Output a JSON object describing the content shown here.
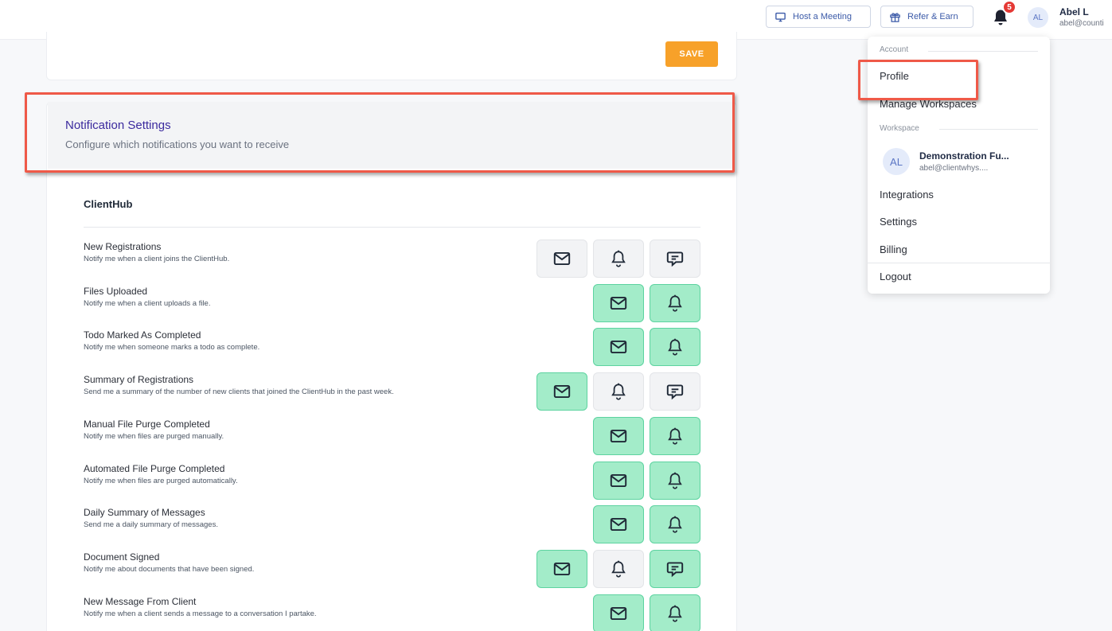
{
  "topbar": {
    "host_meeting": "Host a Meeting",
    "refer_earn": "Refer & Earn",
    "notification_count": "5",
    "avatar_initials": "AL",
    "user_name": "Abel L",
    "user_email": "abel@counti"
  },
  "settings": {
    "save_label": "SAVE"
  },
  "notification_settings": {
    "title": "Notification Settings",
    "subtitle": "Configure which notifications you want to receive",
    "section_title": "ClientHub",
    "rows": [
      {
        "title": "New Registrations",
        "description": "Notify me when a client joins the ClientHub.",
        "email": "off",
        "bell": "off",
        "chat": "off"
      },
      {
        "title": "Files Uploaded",
        "description": "Notify me when a client uploads a file.",
        "email": "on",
        "bell": "on"
      },
      {
        "title": "Todo Marked As Completed",
        "description": "Notify me when someone marks a todo as complete.",
        "email": "on",
        "bell": "on"
      },
      {
        "title": "Summary of Registrations",
        "description": "Send me a summary of the number of new clients that joined the ClientHub in the past week.",
        "email": "on",
        "bell": "off",
        "chat": "off"
      },
      {
        "title": "Manual File Purge Completed",
        "description": "Notify me when files are purged manually.",
        "email": "on",
        "bell": "on"
      },
      {
        "title": "Automated File Purge Completed",
        "description": "Notify me when files are purged automatically.",
        "email": "on",
        "bell": "on"
      },
      {
        "title": "Daily Summary of Messages",
        "description": "Send me a daily summary of messages.",
        "email": "on",
        "bell": "on"
      },
      {
        "title": "Document Signed",
        "description": "Notify me about documents that have been signed.",
        "email": "on",
        "bell": "off",
        "chat": "on"
      },
      {
        "title": "New Message From Client",
        "description": "Notify me when a client sends a message to a conversation I partake.",
        "email": "on",
        "bell": "on"
      }
    ]
  },
  "dropdown": {
    "account_label": "Account",
    "profile": "Profile",
    "manage_workspaces": "Manage Workspaces",
    "workspace_label": "Workspace",
    "workspace_avatar": "AL",
    "workspace_name": "Demonstration Fu...",
    "workspace_email": "abel@clientwhys....",
    "integrations": "Integrations",
    "settings": "Settings",
    "billing": "Billing",
    "logout": "Logout"
  },
  "colors": {
    "save": "#f7a129",
    "toggle_on": "#a3ecc9",
    "toggle_off": "#f2f3f5",
    "highlight": "#ef5948",
    "title": "#3b2a9e"
  }
}
